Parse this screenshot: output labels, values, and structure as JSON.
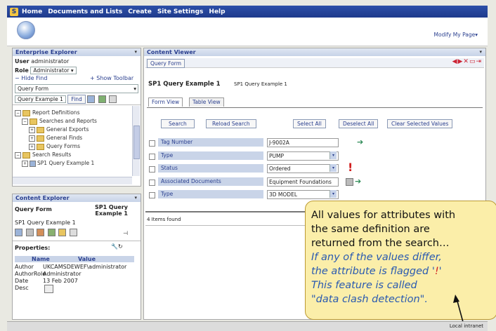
{
  "nav": {
    "items": [
      "Home",
      "Documents and Lists",
      "Create",
      "Site Settings",
      "Help"
    ]
  },
  "banner": {
    "modify_label": "Modify My Page▾"
  },
  "explorer": {
    "title": "Enterprise Explorer",
    "user_label": "User",
    "user_value": "administrator",
    "role_label": "Role",
    "role_value": "Administrator",
    "hide_find": "Hide Find",
    "show_toolbar": "Show Toolbar",
    "query_form_select": "Query Form",
    "query_example_select": "Query Example 1",
    "find_button": "Find",
    "tree": [
      "Report Definitions",
      "Searches and Reports",
      "General Exports",
      "General Finds",
      "Query Forms",
      "Search Results",
      "SP1 Query Example 1"
    ]
  },
  "content_explorer": {
    "title": "Content Explorer",
    "left_label": "Query Form",
    "right_label_1": "SP1 Query",
    "right_label_2": "Example 1",
    "sub_label": "SP1 Query Example 1",
    "properties_label": "Properties:",
    "props_header": [
      "Name",
      "Value"
    ],
    "props": [
      {
        "name": "Author",
        "value": "UKCAMSDEWEF\\administrator"
      },
      {
        "name": "AuthorRole",
        "value": "Administrator"
      },
      {
        "name": "Date",
        "value": "13 Feb 2007"
      },
      {
        "name": "Desc",
        "value": ""
      }
    ]
  },
  "viewer": {
    "title": "Content Viewer",
    "breadcrumb": "Query Form",
    "heading": "SP1 Query Example 1",
    "heading_sub": "SP1 Query Example 1",
    "tabs": [
      "Form View",
      "Table View"
    ],
    "buttons": [
      "Search",
      "Reload Search",
      "Select All",
      "Deselect All",
      "Clear Selected Values"
    ],
    "attributes": [
      {
        "label": "Tag Number",
        "value": "J-9002A",
        "dropdown": false
      },
      {
        "label": "Type",
        "value": "PUMP",
        "dropdown": true
      },
      {
        "label": "Status",
        "value": "Ordered",
        "dropdown": true
      },
      {
        "label": "Associated Documents",
        "value": "Equipment Foundations",
        "dropdown": false
      },
      {
        "label": "Type",
        "value": "3D MODEL",
        "dropdown": true
      }
    ],
    "items_found": "4 Items found"
  },
  "callout": {
    "line1": "All values for attributes with",
    "line2": "the same definition are",
    "line3": "returned from the search…",
    "line4": "If any of the values differ,",
    "line5a": "the attribute is flagged '",
    "line5b": "!",
    "line5c": "'",
    "line6": "This feature is called",
    "line7": "\"data clash detection\"."
  },
  "status": {
    "zone": "Local intranet"
  },
  "colors": {
    "accent": "#2a3f8f",
    "callout_bg": "#fbeea9",
    "flag": "#d12020"
  }
}
